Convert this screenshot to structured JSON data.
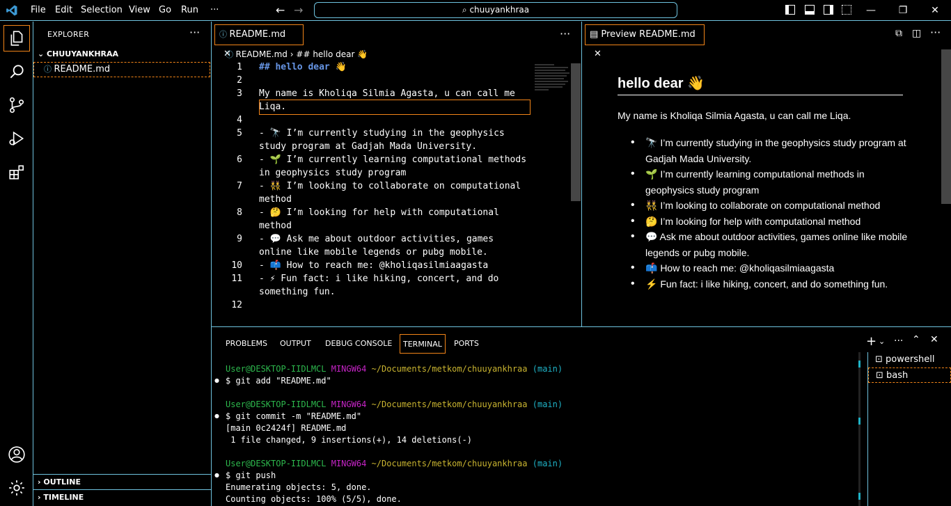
{
  "titlebar": {
    "menus": [
      "File",
      "Edit",
      "Selection",
      "View",
      "Go",
      "Run",
      "···"
    ],
    "search": "chuuyankhraa"
  },
  "explorer": {
    "title": "EXPLORER",
    "folder": "CHUUYANKHRAA",
    "file": "README.md",
    "outline": "OUTLINE",
    "timeline": "TIMELINE"
  },
  "editor": {
    "tab_label": "README.md",
    "breadcrumb_file": "README.md",
    "breadcrumb_symbol": "## hello dear 👋",
    "lines": [
      {
        "n": "1",
        "text": "## hello dear 👋",
        "heading": true
      },
      {
        "n": "2",
        "text": ""
      },
      {
        "n": "3",
        "text": "My name is Kholiqa Silmia Agasta, u can call me"
      },
      {
        "n": "",
        "text": "Liqa."
      },
      {
        "n": "4",
        "text": ""
      },
      {
        "n": "5",
        "text": "- 🔭 I’m currently studying in the geophysics"
      },
      {
        "n": "",
        "text": "study program at Gadjah Mada University."
      },
      {
        "n": "6",
        "text": "- 🌱 I’m currently learning computational methods"
      },
      {
        "n": "",
        "text": "in geophysics study program"
      },
      {
        "n": "7",
        "text": "- 👯 I’m looking to collaborate on computational"
      },
      {
        "n": "",
        "text": "method"
      },
      {
        "n": "8",
        "text": "- 🤔 I’m looking for help with computational"
      },
      {
        "n": "",
        "text": "method"
      },
      {
        "n": "9",
        "text": "- 💬 Ask me about outdoor activities, games"
      },
      {
        "n": "",
        "text": "online like mobile legends or pubg mobile."
      },
      {
        "n": "10",
        "text": "- 📫 How to reach me: @kholiqasilmiaagasta"
      },
      {
        "n": "11",
        "text": "- ⚡ Fun fact: i like hiking, concert, and do"
      },
      {
        "n": "",
        "text": "something fun."
      },
      {
        "n": "12",
        "text": ""
      }
    ]
  },
  "preview": {
    "tab_label": "Preview README.md",
    "heading": "hello dear 👋",
    "intro": "My name is Kholiqa Silmia Agasta, u can call me Liqa.",
    "items": [
      "🔭 I’m currently studying in the geophysics study program at Gadjah Mada University.",
      "🌱 I’m currently learning computational methods in geophysics study program",
      "👯 I’m looking to collaborate on computational method",
      "🤔 I’m looking for help with computational method",
      "💬 Ask me about outdoor activities, games online like mobile legends or pubg mobile.",
      "📫 How to reach me: @kholiqasilmiaagasta",
      "⚡ Fun fact: i like hiking, concert, and do something fun."
    ]
  },
  "panel": {
    "tabs": [
      "PROBLEMS",
      "OUTPUT",
      "DEBUG CONSOLE",
      "TERMINAL",
      "PORTS"
    ],
    "terminals": [
      "powershell",
      "bash"
    ],
    "prompt": {
      "user": "User@DESKTOP-IIDLMCL",
      "shell": "MINGW64",
      "path": "~/Documents/metkom/chuuyankhraa",
      "branch": "(main)"
    },
    "cmd1": "$ git add \"README.md\"",
    "cmd2": "$ git commit -m \"README.md\"",
    "out2a": "[main 0c2424f] README.md",
    "out2b": " 1 file changed, 9 insertions(+), 14 deletions(-)",
    "cmd3": "$ git push",
    "out3a": "Enumerating objects: 5, done.",
    "out3b": "Counting objects: 100% (5/5), done."
  },
  "colors": {
    "border": "#6fc3df",
    "focus": "#f38518",
    "bg": "#000000"
  }
}
